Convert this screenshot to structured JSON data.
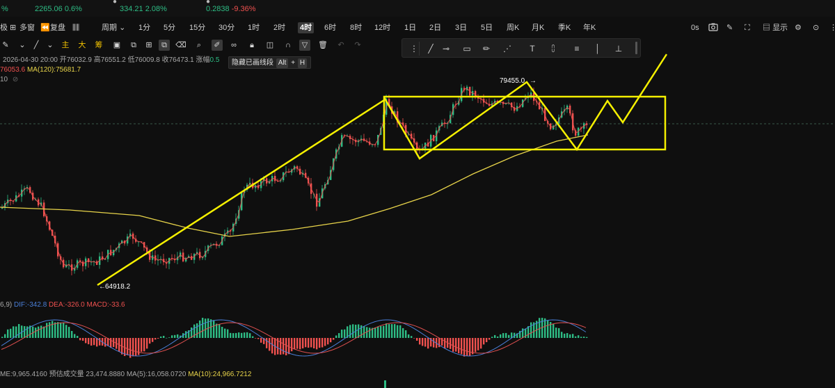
{
  "tickers": [
    {
      "name": "",
      "value": "",
      "change": "%"
    },
    {
      "name": "",
      "value": "2265.06",
      "change": "0.6%"
    },
    {
      "name": "",
      "value": "334.21",
      "change": "2.08%"
    },
    {
      "name": "",
      "value": "0.2838",
      "change": "-9.36%"
    }
  ],
  "toolbar": {
    "left_cut": "极",
    "multi_window": "多窗",
    "replay": "复盘",
    "period": "周期",
    "timeframes": [
      "1分",
      "5分",
      "15分",
      "30分",
      "1时",
      "2时",
      "4时",
      "6时",
      "8时",
      "12时",
      "1日",
      "2日",
      "3日",
      "5日",
      "周K",
      "月K",
      "季K",
      "年K"
    ],
    "active_timeframe": "4时",
    "timer": "0s",
    "display": "显示"
  },
  "indicators_toolbar": {
    "main": "主",
    "big": "大",
    "chip": "筹"
  },
  "tooltip": {
    "text": "隐藏已画线段",
    "key1": "Alt",
    "plus": "+",
    "key2": "H"
  },
  "ohlc": {
    "date": "2026-04-30 20:00",
    "open_label": "开",
    "open": "76032.9",
    "high_label": "高",
    "high": "76551.2",
    "low_label": "低",
    "low": "76009.8",
    "close_label": "收",
    "close": "76473.1",
    "change_label": "涨幅",
    "change": "0.5"
  },
  "ma_row": {
    "ma_short_value": "76053.6",
    "ma120_label": "MA(120):",
    "ma120_value": "75681.7",
    "third_row": "10"
  },
  "price_labels": {
    "high_mark": "79455.0",
    "low_mark": "64918.2"
  },
  "macd": {
    "params": "6,9)",
    "dif_label": "DIF:",
    "dif": "-342.8",
    "dea_label": "DEA:",
    "dea": "-326.0",
    "macd_label": "MACD:",
    "macd": "-33.6"
  },
  "volume": {
    "vol_label": "ME:",
    "vol": "9,965.4160",
    "est_label": "预估成交量",
    "est": "23,474.8880",
    "ma5_label": "MA(5):",
    "ma5": "16,058.0720",
    "ma10_label": "MA(10):",
    "ma10": "24,966.7212"
  },
  "colors": {
    "up": "#2ebd85",
    "down": "#f0514f",
    "ma120": "#e8d44a",
    "drawing": "#f5f000",
    "dif": "#4a7fd8",
    "dea": "#e05050"
  },
  "icons": [
    "camera-icon",
    "pencil-icon",
    "settings-icon",
    "fullscreen-icon",
    "undo-icon",
    "redo-icon",
    "trash-icon",
    "lock-icon",
    "magnet-icon",
    "filter-icon"
  ]
}
